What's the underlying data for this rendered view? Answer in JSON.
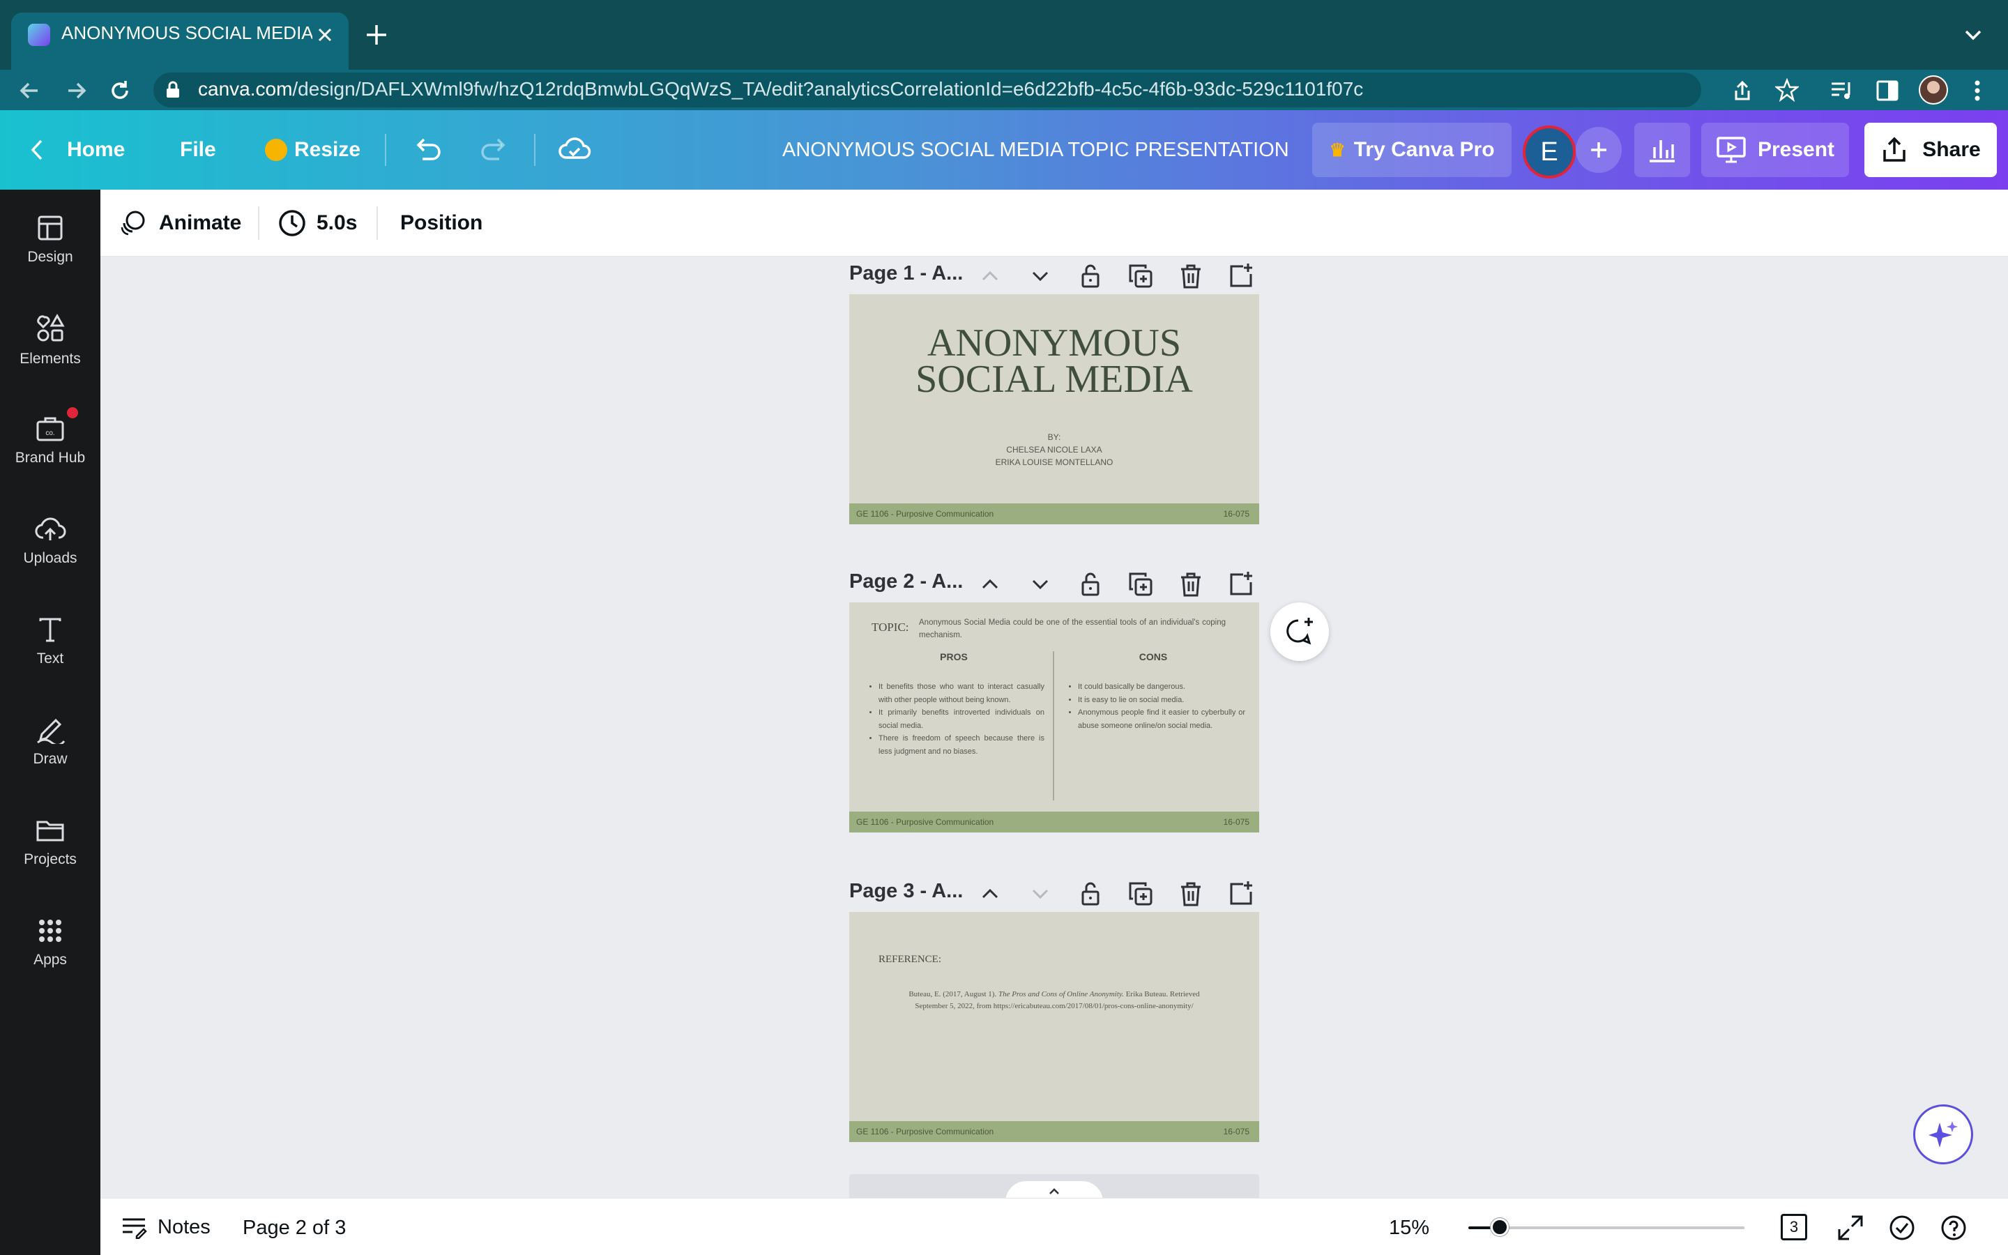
{
  "browser": {
    "tab_title": "ANONYMOUS SOCIAL MEDIA T",
    "url_domain": "canva.com",
    "url_path": "/design/DAFLXWml9fw/hzQ12rdqBmwbLGQqWzS_TA/edit?analyticsCorrelationId=e6d22bfb-4c5c-4f6b-93dc-529c1101f07c"
  },
  "header": {
    "home": "Home",
    "file": "File",
    "resize": "Resize",
    "title": "ANONYMOUS SOCIAL MEDIA TOPIC PRESENTATION",
    "try_pro": "Try Canva Pro",
    "avatar_letter": "E",
    "present": "Present",
    "share": "Share"
  },
  "sidebar": {
    "items": [
      {
        "label": "Design"
      },
      {
        "label": "Elements"
      },
      {
        "label": "Brand Hub"
      },
      {
        "label": "Uploads"
      },
      {
        "label": "Text"
      },
      {
        "label": "Draw"
      },
      {
        "label": "Projects"
      },
      {
        "label": "Apps"
      }
    ]
  },
  "toolbar": {
    "animate": "Animate",
    "duration": "5.0s",
    "position": "Position"
  },
  "pages": [
    {
      "label": "Page 1 - A..."
    },
    {
      "label": "Page 2 - A..."
    },
    {
      "label": "Page 3 - A..."
    }
  ],
  "slide1": {
    "title_line1": "ANONYMOUS",
    "title_line2": "SOCIAL MEDIA",
    "by": "BY:",
    "author1": "CHELSEA NICOLE LAXA",
    "author2": "ERIKA LOUISE MONTELLANO"
  },
  "slide2": {
    "topic_label": "TOPIC:",
    "topic_text": "Anonymous Social Media could be one of the essential tools of an individual's coping mechanism.",
    "pros_header": "PROS",
    "cons_header": "CONS",
    "pros": [
      "It benefits those who want to interact casually with other people without being known.",
      "It primarily benefits introverted individuals on social media.",
      "There is freedom of speech because there is less judgment and no biases."
    ],
    "cons": [
      "It could basically be dangerous.",
      "It is easy to lie on social media.",
      "Anonymous people find it easier to cyberbully or abuse someone online/on social media."
    ]
  },
  "slide3": {
    "reference_label": "REFERENCE:",
    "ref_part1": "Buteau, E. (2017, August 1).",
    "ref_italic": "The Pros and Cons of Online Anonymity.",
    "ref_part2": "Erika Buteau. Retrieved",
    "ref_line2": "September 5, 2022, from https://ericabuteau.com/2017/08/01/pros-cons-online-anonymity/"
  },
  "footer": {
    "course": "GE 1106 - Purposive Communication",
    "code": "16-075"
  },
  "bottom": {
    "notes": "Notes",
    "page_indicator": "Page 2 of 3",
    "zoom": "15%",
    "zoom_level": 0.15,
    "page_count": "3"
  },
  "colors": {
    "header_start": "#19c1cf",
    "header_end": "#7b3ff0",
    "sidebar_bg": "#18191b",
    "slide_bg": "#d7d6cb",
    "slide_footer": "#9bae80",
    "title_green": "#3f4f3c"
  }
}
